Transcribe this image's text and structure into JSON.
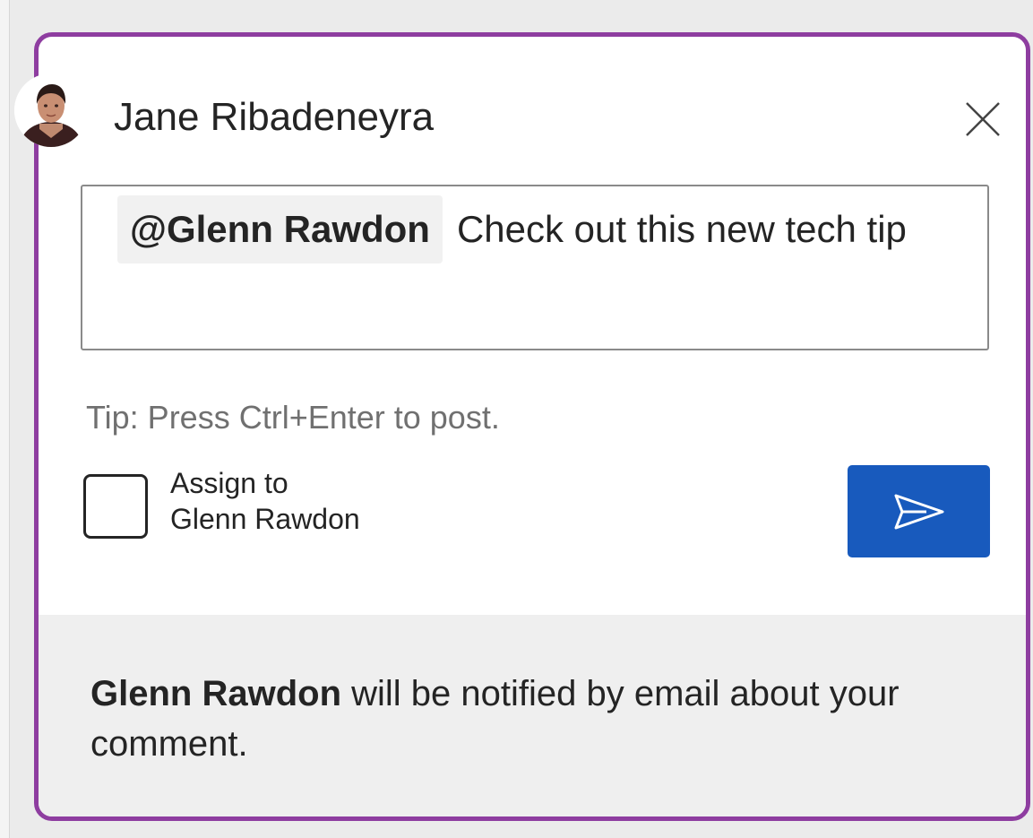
{
  "comment": {
    "author_name": "Jane Ribadeneyra",
    "mention": "@Glenn Rawdon",
    "body_text": "Check out this new tech tip",
    "tip": "Tip: Press Ctrl+Enter to post.",
    "assign_label_line1": "Assign to",
    "assign_label_line2": "Glenn Rawdon",
    "assign_checked": false
  },
  "footer": {
    "notify_name": "Glenn Rawdon",
    "notify_text": "will be notified by email about your comment."
  },
  "icons": {
    "close": "close-icon",
    "send": "send-icon",
    "avatar": "avatar"
  },
  "colors": {
    "accent_border": "#8e3da0",
    "send_button": "#185abd",
    "footer_bg": "#efefef",
    "tip_text": "#707070"
  }
}
